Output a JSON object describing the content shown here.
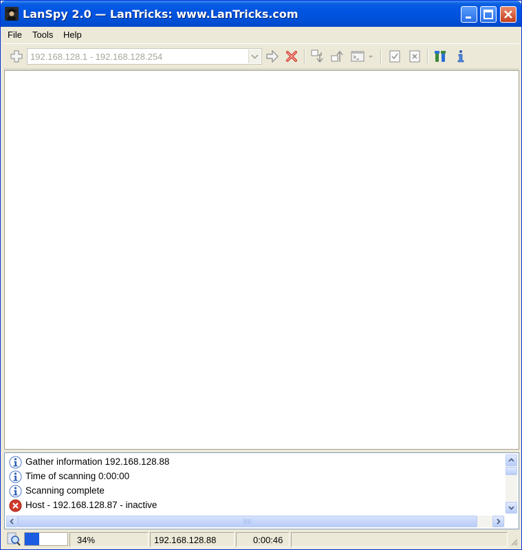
{
  "window": {
    "title": "LanSpy 2.0 — LanTricks: www.LanTricks.com"
  },
  "menu": {
    "items": [
      "File",
      "Tools",
      "Help"
    ]
  },
  "toolbar": {
    "range_value": "192.168.128.1 - 192.168.128.254",
    "icons": [
      "add-icon",
      "go-arrow-icon",
      "stop-icon",
      "import-icon",
      "export-icon",
      "terminal-icon",
      "dropdown-arrow-icon",
      "check-report-icon",
      "clear-report-icon",
      "tools-icon",
      "info-icon"
    ]
  },
  "log": {
    "entries": [
      {
        "type": "info",
        "text": "Gather information 192.168.128.88"
      },
      {
        "type": "info",
        "text": "Time of scanning 0:00:00"
      },
      {
        "type": "info",
        "text": "Scanning complete"
      },
      {
        "type": "error",
        "text": "Host - 192.168.128.87 - inactive"
      }
    ]
  },
  "status": {
    "progress_fraction": 0.34,
    "percent": "34%",
    "host": "192.168.128.88",
    "elapsed": "0:00:46"
  },
  "colors": {
    "title_bar": "#0054e3",
    "progress": "#1c5ce0",
    "error": "#d23a2a",
    "info": "#2c5fb3"
  }
}
